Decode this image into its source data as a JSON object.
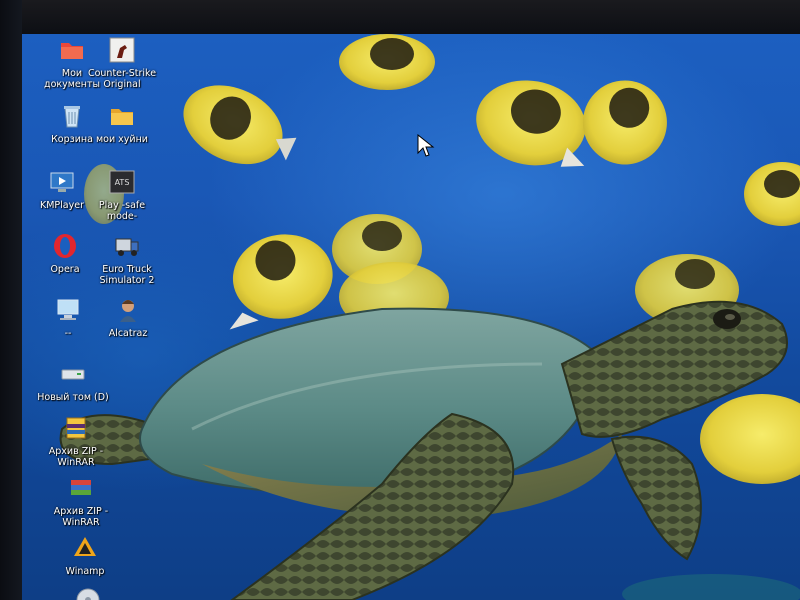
{
  "desktop": {
    "icons": [
      {
        "label": "Мои\nдокументы",
        "icon": "folder-documents-icon"
      },
      {
        "label": "Counter-Strike\nOriginal",
        "icon": "counter-strike-icon"
      },
      {
        "label": "Корзина",
        "icon": "recycle-bin-icon"
      },
      {
        "label": "мои  хуйни",
        "icon": "folder-icon"
      },
      {
        "label": "KMPlayer",
        "icon": "kmplayer-icon"
      },
      {
        "label": "Play -safe\nmode-",
        "icon": "play-safe-mode-icon"
      },
      {
        "label": "Opera",
        "icon": "opera-icon"
      },
      {
        "label": "Euro Truck\nSimulator 2",
        "icon": "euro-truck-simulator-icon"
      },
      {
        "label": "--",
        "icon": "my-computer-icon"
      },
      {
        "label": "Alcatraz",
        "icon": "alcatraz-icon"
      },
      {
        "label": "Новый том (D)",
        "icon": "drive-icon"
      },
      {
        "label": "Архив ZIP -\nWinRAR",
        "icon": "zip-archive-icon"
      },
      {
        "label": "Архив ZIP -\nWinRAR",
        "icon": "winrar-archive-icon"
      },
      {
        "label": "Winamp",
        "icon": "winamp-icon"
      }
    ]
  },
  "wallpaper": {
    "subject": "sea-turtle-and-fish",
    "colors": {
      "water": "#1a57b5",
      "fish_yellow": "#e8d84a",
      "turtle_shell": "#5f8c8a"
    }
  }
}
